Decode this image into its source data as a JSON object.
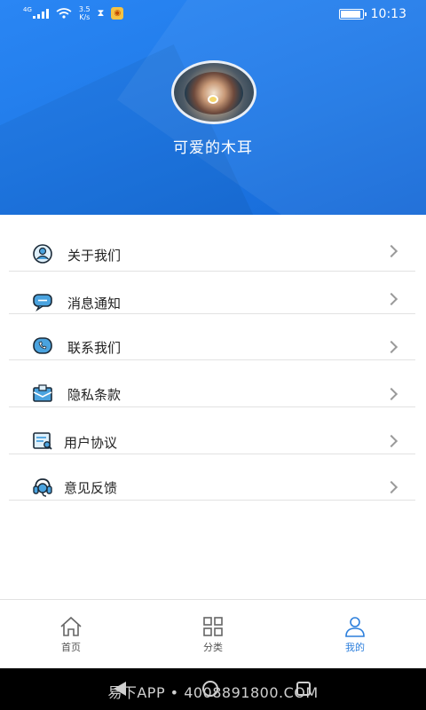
{
  "status_bar": {
    "network_type": "4G",
    "speed_value": "3.5",
    "speed_unit": "K/s",
    "time": "10:13",
    "battery_level": 0.95
  },
  "profile": {
    "username": "可爱的木耳"
  },
  "menu": {
    "items": [
      {
        "label": "关于我们",
        "icon": "person-circle-icon"
      },
      {
        "label": "消息通知",
        "icon": "chat-bubble-icon"
      },
      {
        "label": "联系我们",
        "icon": "phone-icon"
      },
      {
        "label": "隐私条款",
        "icon": "envelope-icon"
      },
      {
        "label": "用户协议",
        "icon": "document-search-icon"
      },
      {
        "label": "意见反馈",
        "icon": "headset-icon"
      }
    ]
  },
  "bottom_nav": {
    "home": "首页",
    "category": "分类",
    "mine": "我的",
    "active": "mine",
    "active_color": "#2d7fdc"
  },
  "system_bar": {
    "watermark": "易下APP • 4008891800.COM"
  },
  "colors": {
    "header_blue": "#1f7ae8",
    "icon_blue": "#4aa3df"
  }
}
